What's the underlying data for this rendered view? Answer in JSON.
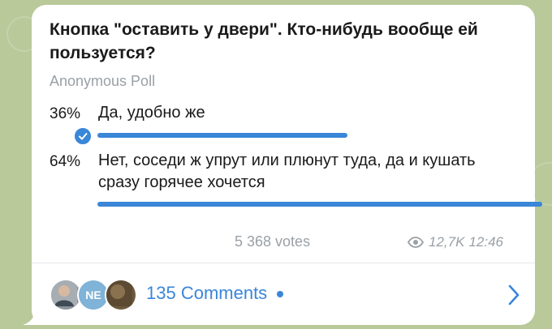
{
  "poll": {
    "question": "Кнопка \"оставить у двери\". Кто-нибудь вообще ей пользуется?",
    "type_label": "Anonymous Poll",
    "options": [
      {
        "percent": "36%",
        "text": "Да, удобно же",
        "fraction": 0.36,
        "chosen": true
      },
      {
        "percent": "64%",
        "text": "Нет, соседи ж упрут или плюнут туда, да и кушать сразу горячее хочется",
        "fraction": 0.64,
        "chosen": false
      }
    ],
    "votes": "5 368 votes"
  },
  "meta": {
    "views": "12,7K",
    "time": "12:46"
  },
  "footer": {
    "comments_label": "135 Comments",
    "avatar_initials": "NE"
  },
  "colors": {
    "accent": "#3a86d8",
    "muted_text": "#9aa0a6",
    "background": "#b9c99a"
  },
  "icons": [
    "check-icon",
    "eye-icon",
    "chevron-right-icon",
    "unread-dot-icon"
  ]
}
